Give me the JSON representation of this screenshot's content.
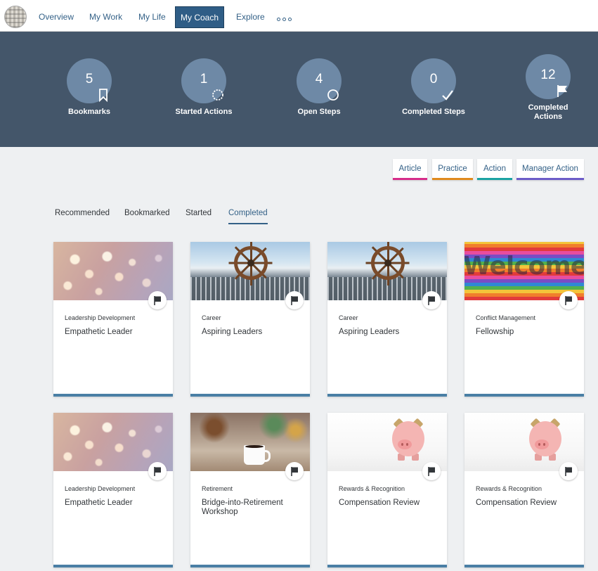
{
  "nav": {
    "items": [
      {
        "label": "Overview"
      },
      {
        "label": "My Work"
      },
      {
        "label": "My Life"
      },
      {
        "label": "My Coach",
        "active": true
      },
      {
        "label": "Explore"
      }
    ],
    "more_icon": "more-horizontal-icon"
  },
  "stats": [
    {
      "value": "5",
      "label": "Bookmarks",
      "icon": "bookmark-icon"
    },
    {
      "value": "1",
      "label": "Started Actions",
      "icon": "progress-circle-icon"
    },
    {
      "value": "4",
      "label": "Open Steps",
      "icon": "open-circle-icon"
    },
    {
      "value": "0",
      "label": "Completed Steps",
      "icon": "checkmark-icon"
    },
    {
      "value": "12",
      "label": "Completed Actions",
      "icon": "flag-icon"
    }
  ],
  "type_buttons": [
    {
      "label": "Article",
      "color": "#d62d8a"
    },
    {
      "label": "Practice",
      "color": "#e08a1e"
    },
    {
      "label": "Action",
      "color": "#1ba3a3"
    },
    {
      "label": "Manager Action",
      "color": "#6c5cc8"
    }
  ],
  "tabs": [
    {
      "label": "Recommended"
    },
    {
      "label": "Bookmarked"
    },
    {
      "label": "Started"
    },
    {
      "label": "Completed",
      "active": true
    }
  ],
  "cards": [
    {
      "category": "Leadership Development",
      "title": "Empathetic Leader",
      "image": "bokeh"
    },
    {
      "category": "Career",
      "title": "Aspiring Leaders",
      "image": "ship-wheel"
    },
    {
      "category": "Career",
      "title": "Aspiring Leaders",
      "image": "ship-wheel"
    },
    {
      "category": "Conflict Management",
      "title": "Fellowship",
      "image": "welcome-wall",
      "image_text": "Welcome"
    },
    {
      "category": "Leadership Development",
      "title": "Empathetic Leader",
      "image": "bokeh"
    },
    {
      "category": "Retirement",
      "title": "Bridge-into-Retirement Workshop",
      "image": "coffee-mug"
    },
    {
      "category": "Rewards & Recognition",
      "title": "Compensation Review",
      "image": "piggy-bank"
    },
    {
      "category": "Rewards & Recognition",
      "title": "Compensation Review",
      "image": "piggy-bank"
    }
  ],
  "colors": {
    "nav_active": "#2f5d86",
    "stats_band": "#44566a",
    "stat_circle": "#6e89a6",
    "card_footer": "#4a7fa5",
    "link": "#346187"
  }
}
